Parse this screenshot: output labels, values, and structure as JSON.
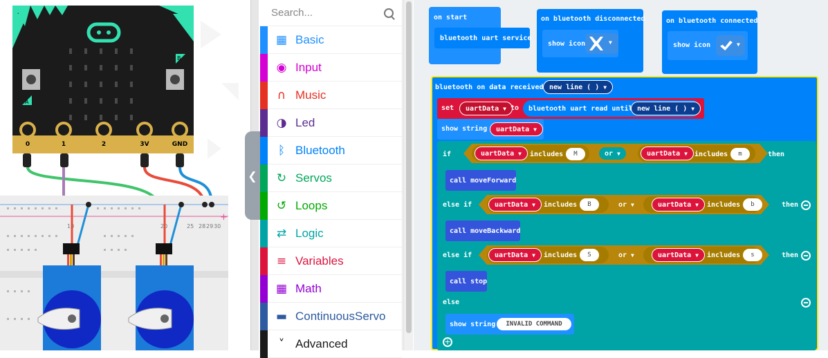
{
  "simulator": {
    "pins": [
      "0",
      "1",
      "2",
      "3V",
      "GND"
    ],
    "buttons": [
      "A",
      "B"
    ],
    "breadboard_numbers": [
      "10",
      "20",
      "25",
      "28",
      "29",
      "30"
    ]
  },
  "toolbox": {
    "search_placeholder": "Search...",
    "categories": [
      {
        "label": "Basic",
        "color": "#1e90ff",
        "icon": "grid-icon"
      },
      {
        "label": "Input",
        "color": "#d400d4",
        "icon": "target-icon"
      },
      {
        "label": "Music",
        "color": "#e63022",
        "icon": "headphones-icon"
      },
      {
        "label": "Led",
        "color": "#5c2d91",
        "icon": "toggle-icon"
      },
      {
        "label": "Bluetooth",
        "color": "#0082fb",
        "icon": "bluetooth-icon"
      },
      {
        "label": "Servos",
        "color": "#00a65a",
        "icon": "sync-icon"
      },
      {
        "label": "Loops",
        "color": "#00aa00",
        "icon": "refresh-icon"
      },
      {
        "label": "Logic",
        "color": "#00a4a6",
        "icon": "shuffle-icon"
      },
      {
        "label": "Variables",
        "color": "#dc143c",
        "icon": "list-icon"
      },
      {
        "label": "Math",
        "color": "#9400d3",
        "icon": "calculator-icon"
      },
      {
        "label": "ContinuousServo",
        "color": "#2d5aa0",
        "icon": "car-icon"
      },
      {
        "label": "Advanced",
        "color": "#1a1a1a",
        "icon": "chevron-icon"
      }
    ]
  },
  "workspace": {
    "on_start": {
      "label": "on start",
      "child": "bluetooth uart service"
    },
    "on_disconnected": {
      "label": "on bluetooth disconnected",
      "child": "show icon"
    },
    "on_connected": {
      "label": "on bluetooth connected",
      "child": "show icon"
    },
    "on_received": {
      "label": "bluetooth on data received",
      "delimiter": "new line ( )"
    },
    "set_block": {
      "set": "set",
      "var": "uartData",
      "to": "to",
      "read": "bluetooth uart read until",
      "delimiter": "new line ( )"
    },
    "show_string": {
      "label": "show string",
      "var": "uartData"
    },
    "if_block": {
      "if": "if",
      "else_if": "else if",
      "else": "else",
      "then": "then",
      "or": "or",
      "includes": "includes",
      "var": "uartData",
      "branches": [
        {
          "a": "M",
          "b": "m",
          "call": "call moveForward"
        },
        {
          "a": "B",
          "b": "b",
          "call": "call moveBackward"
        },
        {
          "a": "S",
          "b": "s",
          "call": "call stop"
        }
      ],
      "else_show": "show string",
      "else_text": "INVALID COMMAND"
    }
  }
}
